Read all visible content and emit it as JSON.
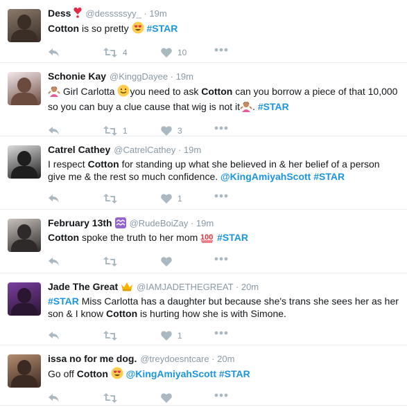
{
  "tweets": [
    {
      "name": "Dess",
      "name_emoji": "❣",
      "handle": "@desssssyy_",
      "time": "19m",
      "text": [
        {
          "t": "b",
          "v": "Cotton"
        },
        {
          "t": "n",
          "v": " is so pretty "
        },
        {
          "t": "e",
          "v": "heart-eyes"
        },
        {
          "t": "n",
          "v": " "
        },
        {
          "t": "h",
          "v": "#STAR"
        }
      ],
      "retweets": "4",
      "likes": "10",
      "avatar_colors": [
        "#8a7a6a",
        "#3a2e27"
      ]
    },
    {
      "name": "Schonie Kay",
      "name_emoji": "",
      "handle": "@KinggDayee",
      "time": "19m",
      "text": [
        {
          "t": "e",
          "v": "woman-shrug"
        },
        {
          "t": "n",
          "v": " Girl Carlotta "
        },
        {
          "t": "e",
          "v": "grin-face"
        },
        {
          "t": "n",
          "v": "you need to ask "
        },
        {
          "t": "b",
          "v": "Cotton"
        },
        {
          "t": "n",
          "v": " can  you borrow a piece of that 10,000 so you can buy a clue cause that wig is not it"
        },
        {
          "t": "e",
          "v": "woman-shrug"
        },
        {
          "t": "n",
          "v": ". "
        },
        {
          "t": "h",
          "v": "#STAR"
        }
      ],
      "retweets": "1",
      "likes": "3",
      "avatar_colors": [
        "#f3e7ea",
        "#6b4b3e"
      ]
    },
    {
      "name": "Catrel Cathey",
      "name_emoji": "",
      "handle": "@CatrelCathey",
      "time": "19m",
      "text": [
        {
          "t": "n",
          "v": "I respect "
        },
        {
          "t": "b",
          "v": "Cotton"
        },
        {
          "t": "n",
          "v": " for standing up what she believed in & her belief of a person give me & the rest so much confidence. "
        },
        {
          "t": "m",
          "v": "@KingAmiyahScott"
        },
        {
          "t": "n",
          "v": " "
        },
        {
          "t": "h",
          "v": "#STAR"
        }
      ],
      "retweets": "",
      "likes": "1",
      "avatar_colors": [
        "#dcdcdc",
        "#1e1e1e"
      ]
    },
    {
      "name": "February 13th",
      "name_emoji": "♒",
      "handle": "@RudeBoiZay",
      "time": "19m",
      "text": [
        {
          "t": "b",
          "v": "Cotton"
        },
        {
          "t": "n",
          "v": " spoke the truth to her mom "
        },
        {
          "t": "e",
          "v": "hundred"
        },
        {
          "t": "n",
          "v": " "
        },
        {
          "t": "h",
          "v": "#STAR"
        }
      ],
      "retweets": "",
      "likes": "",
      "avatar_colors": [
        "#c9c2bb",
        "#2f2a2a"
      ]
    },
    {
      "name": "Jade The Great",
      "name_emoji": "👑",
      "handle": "@IAMJADETHEGREAT",
      "time": "20m",
      "text": [
        {
          "t": "h",
          "v": "#STAR"
        },
        {
          "t": "n",
          "v": " Miss Carlotta has a daughter but because she's trans she sees her as her son & I know "
        },
        {
          "t": "b",
          "v": "Cotton"
        },
        {
          "t": "n",
          "v": " is hurting how she is with Simone."
        }
      ],
      "retweets": "",
      "likes": "1",
      "avatar_colors": [
        "#7a3fa0",
        "#2a1630"
      ]
    },
    {
      "name": "issa no for me dog.",
      "name_emoji": "",
      "handle": "@treydoesntcare",
      "time": "20m",
      "text": [
        {
          "t": "n",
          "v": "Go off "
        },
        {
          "t": "b",
          "v": "Cotton"
        },
        {
          "t": "n",
          "v": " "
        },
        {
          "t": "e",
          "v": "heart-eyes"
        },
        {
          "t": "n",
          "v": " "
        },
        {
          "t": "m",
          "v": "@KingAmiyahScott"
        },
        {
          "t": "n",
          "v": " "
        },
        {
          "t": "h",
          "v": "#STAR"
        }
      ],
      "retweets": "",
      "likes": "",
      "avatar_colors": [
        "#b48c70",
        "#3b2a22"
      ]
    }
  ]
}
